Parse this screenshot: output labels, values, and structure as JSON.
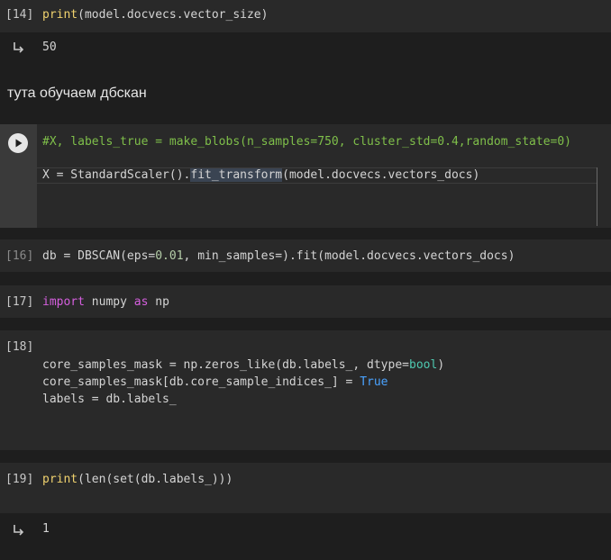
{
  "cells": {
    "c14": {
      "prompt": "[14]",
      "code": {
        "fn": "print",
        "rest": "(model.docvecs.vector_size)"
      },
      "output": "50"
    },
    "markdown": {
      "text": "тута обучаем дбскан"
    },
    "c15": {
      "comment": "#X, labels_true = make_blobs(n_samples=750, cluster_std=0.4,random_state=0)",
      "line2_pre": "X = StandardScaler().",
      "line2_hl": "fit_transform",
      "line2_post": "(model.docvecs.vectors_docs)"
    },
    "c16": {
      "prompt": "[16]",
      "code_pre": "db = DBSCAN(eps=",
      "code_num": "0.01",
      "code_post": ", min_samples=).fit(model.docvecs.vectors_docs)"
    },
    "c17": {
      "prompt": "[17]",
      "kw_import": "import",
      "mod": " numpy ",
      "kw_as": "as",
      "alias": " np"
    },
    "c18": {
      "prompt": "[18]",
      "line1_pre": "core_samples_mask = np.zeros_like(db.labels_, dtype=",
      "line1_bool": "bool",
      "line1_post": ")",
      "line2_pre": "core_samples_mask[db.core_sample_indices_] = ",
      "line2_true": "True",
      "line3": "labels = db.labels_"
    },
    "c19": {
      "prompt": "[19]",
      "fn": "print",
      "rest": "(len(set(db.labels_)))",
      "output": "1"
    }
  },
  "icons": {
    "output": "output-arrow-icon",
    "run": "run-cell-icon"
  }
}
